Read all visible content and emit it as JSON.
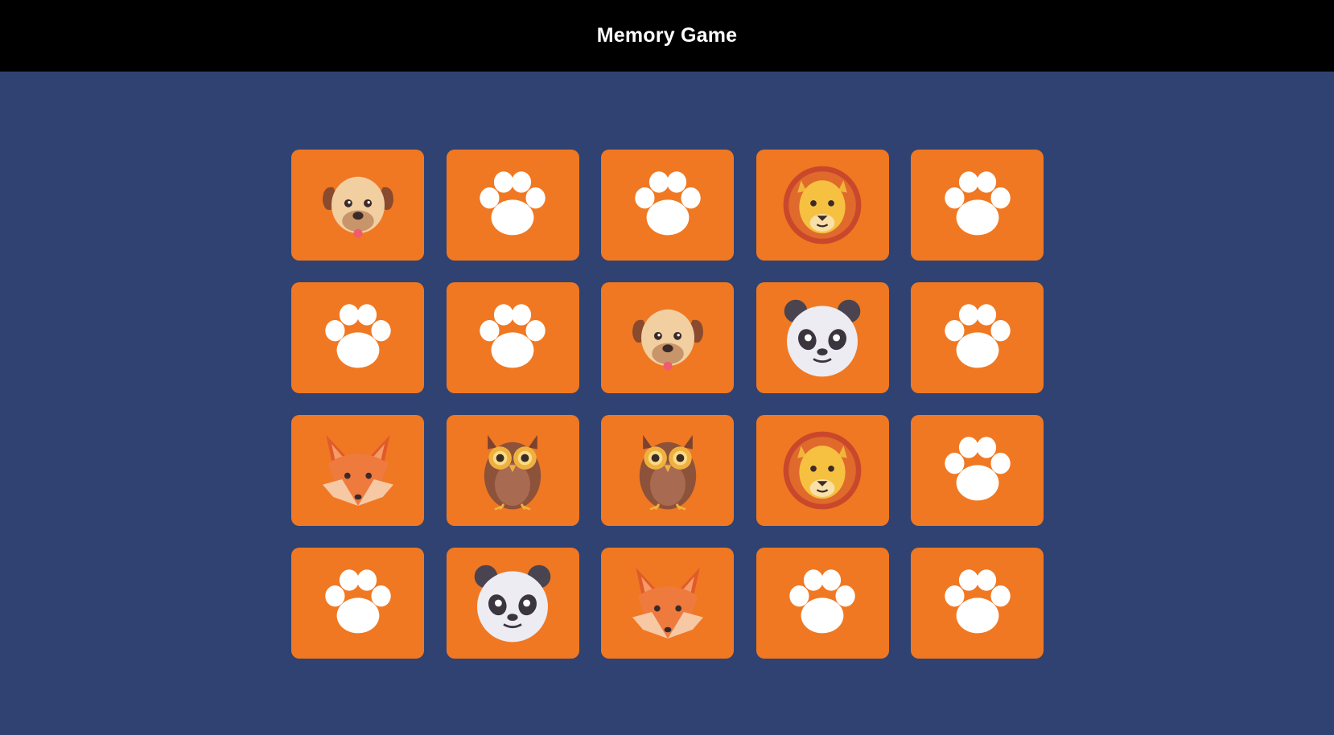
{
  "header": {
    "title": "Memory Game"
  },
  "colors": {
    "background": "#2f4272",
    "header": "#000000",
    "card": "#f07822",
    "paw": "#ffffff"
  },
  "board": {
    "rows": 4,
    "columns": 5,
    "cards": [
      {
        "state": "revealed",
        "icon": "dog-icon"
      },
      {
        "state": "hidden",
        "icon": "paw-icon"
      },
      {
        "state": "hidden",
        "icon": "paw-icon"
      },
      {
        "state": "revealed",
        "icon": "lion-icon"
      },
      {
        "state": "hidden",
        "icon": "paw-icon"
      },
      {
        "state": "hidden",
        "icon": "paw-icon"
      },
      {
        "state": "hidden",
        "icon": "paw-icon"
      },
      {
        "state": "revealed",
        "icon": "dog-icon"
      },
      {
        "state": "revealed",
        "icon": "panda-icon"
      },
      {
        "state": "hidden",
        "icon": "paw-icon"
      },
      {
        "state": "revealed",
        "icon": "fox-icon"
      },
      {
        "state": "revealed",
        "icon": "owl-icon"
      },
      {
        "state": "revealed",
        "icon": "owl-icon"
      },
      {
        "state": "revealed",
        "icon": "lion-icon"
      },
      {
        "state": "hidden",
        "icon": "paw-icon"
      },
      {
        "state": "hidden",
        "icon": "paw-icon"
      },
      {
        "state": "revealed",
        "icon": "panda-icon"
      },
      {
        "state": "revealed",
        "icon": "fox-icon"
      },
      {
        "state": "hidden",
        "icon": "paw-icon"
      },
      {
        "state": "hidden",
        "icon": "paw-icon"
      }
    ]
  }
}
